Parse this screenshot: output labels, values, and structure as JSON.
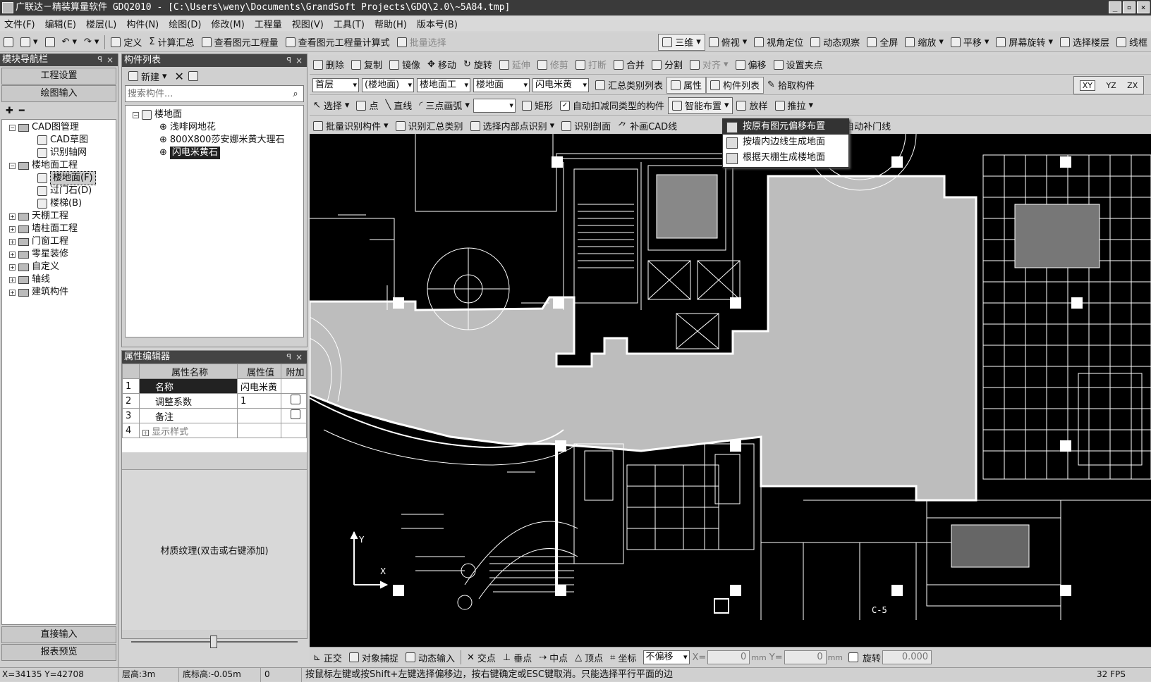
{
  "window": {
    "title": "广联达－精装算量软件 GDQ2010 - [C:\\Users\\weny\\Documents\\GrandSoft Projects\\GDQ\\2.0\\~5A84.tmp]",
    "buttons": [
      "_",
      "▫",
      "×"
    ]
  },
  "menu": [
    "文件(F)",
    "编辑(E)",
    "楼层(L)",
    "构件(N)",
    "绘图(D)",
    "修改(M)",
    "工程量",
    "视图(V)",
    "工具(T)",
    "帮助(H)",
    "版本号(B)"
  ],
  "toolbar1": {
    "left": [
      "定义",
      "计算汇总",
      "查看图元工程量",
      "查看图元工程量计算式",
      "批量选择"
    ],
    "right": [
      "三维",
      "俯视",
      "视角定位",
      "动态观察",
      "全屏",
      "缩放",
      "平移",
      "屏幕旋转",
      "选择楼层",
      "线框"
    ]
  },
  "toolbar2": [
    "删除",
    "复制",
    "镜像",
    "移动",
    "旋转",
    "延伸",
    "修剪",
    "打断",
    "合并",
    "分割",
    "对齐",
    "偏移",
    "设置夹点"
  ],
  "toolbar3": {
    "combos": [
      "首层",
      "(楼地面)",
      "楼地面工",
      "楼地面",
      "闪电米黄"
    ],
    "buttons": [
      "汇总类别列表",
      "属性",
      "构件列表",
      "拾取构件"
    ]
  },
  "toolbar4": {
    "select": "选择",
    "buttons": [
      "点",
      "直线",
      "三点画弧",
      "矩形"
    ],
    "checkbox": "自动扣减同类型的构件",
    "smart": "智能布置",
    "extra": [
      "放样",
      "推拉"
    ]
  },
  "toolbar5": [
    "批量识别构件",
    "识别汇总类别",
    "选择内部点识别",
    "识别剖面",
    "补画CAD线",
    "自动补门线"
  ],
  "view_buttons": [
    "XY",
    "YZ",
    "ZX"
  ],
  "smart_menu": [
    "按原有图元偏移布置",
    "按墙内边线生成地面",
    "根据天棚生成楼地面"
  ],
  "nav": {
    "title": "模块导航栏",
    "project_settings": "工程设置",
    "draw_input": "绘图输入",
    "tree": [
      {
        "label": "CAD图管理",
        "level": 0,
        "exp": "-"
      },
      {
        "label": "CAD草图",
        "level": 1
      },
      {
        "label": "识别轴网",
        "level": 1
      },
      {
        "label": "楼地面工程",
        "level": 0,
        "exp": "-"
      },
      {
        "label": "楼地面(F)",
        "level": 1,
        "selected": true
      },
      {
        "label": "过门石(D)",
        "level": 1
      },
      {
        "label": "楼梯(B)",
        "level": 1
      },
      {
        "label": "天棚工程",
        "level": 0,
        "exp": "+"
      },
      {
        "label": "墙柱面工程",
        "level": 0,
        "exp": "+"
      },
      {
        "label": "门窗工程",
        "level": 0,
        "exp": "+"
      },
      {
        "label": "零星装修",
        "level": 0,
        "exp": "+"
      },
      {
        "label": "自定义",
        "level": 0,
        "exp": "+"
      },
      {
        "label": "轴线",
        "level": 0,
        "exp": "+"
      },
      {
        "label": "建筑构件",
        "level": 0,
        "exp": "+"
      }
    ],
    "direct_input": "直接输入",
    "report_preview": "报表预览"
  },
  "components": {
    "title": "构件列表",
    "new_label": "新建",
    "search_placeholder": "搜索构件...",
    "root": "楼地面",
    "items": [
      "浅啡网地花",
      "800X800莎安娜米黄大理石",
      "闪电米黄石"
    ]
  },
  "properties": {
    "title": "属性编辑器",
    "headers": [
      "属性名称",
      "属性值",
      "附加"
    ],
    "rows": [
      {
        "no": "1",
        "name": "名称",
        "value": "闪电米黄"
      },
      {
        "no": "2",
        "name": "调整系数",
        "value": "1"
      },
      {
        "no": "3",
        "name": "备注",
        "value": ""
      },
      {
        "no": "4",
        "name": "显示样式",
        "value": ""
      }
    ],
    "texture_hint": "材质纹理(双击或右键添加)"
  },
  "snapbar": {
    "buttons": [
      "正交",
      "对象捕捉",
      "动态输入",
      "交点",
      "垂点",
      "中点",
      "顶点",
      "坐标"
    ],
    "offset_mode": "不偏移",
    "x_label": "X=",
    "x_value": "0",
    "y_label": "Y=",
    "y_value": "0",
    "unit": "mm",
    "rotate_label": "旋转",
    "rotate_value": "0.000"
  },
  "status": {
    "coords": "X=34135 Y=42708",
    "floor_height": "层高:3m",
    "base_height": "底标高:-0.05m",
    "count": "0",
    "hint": "按鼠标左键或按Shift+左键选择偏移边，按右键确定或ESC键取消。只能选择平行平面的边",
    "fps": "32 FPS"
  },
  "cad_labels": {
    "room_label": "C-5",
    "axis_y": "Y",
    "axis_x": "X"
  }
}
